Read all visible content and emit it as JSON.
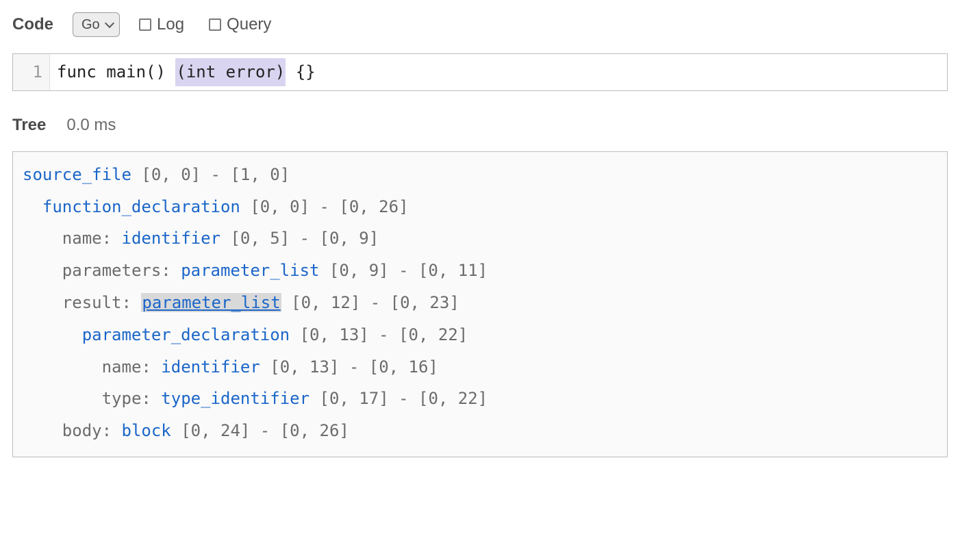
{
  "toolbar": {
    "code_label": "Code",
    "language_selected": "Go",
    "log_label": "Log",
    "query_label": "Query",
    "log_checked": false,
    "query_checked": false
  },
  "editor": {
    "line_number": "1",
    "segments": {
      "pre": "func main() ",
      "highlight": "(int error)",
      "post": " {}"
    }
  },
  "tree_header": {
    "label": "Tree",
    "timing": "0.0 ms"
  },
  "tree": [
    {
      "indent": 0,
      "field": null,
      "type": "source_file",
      "pos": "[0, 0] - [1, 0]",
      "selected": false
    },
    {
      "indent": 1,
      "field": null,
      "type": "function_declaration",
      "pos": "[0, 0] - [0, 26]",
      "selected": false
    },
    {
      "indent": 2,
      "field": "name",
      "type": "identifier",
      "pos": "[0, 5] - [0, 9]",
      "selected": false
    },
    {
      "indent": 2,
      "field": "parameters",
      "type": "parameter_list",
      "pos": "[0, 9] - [0, 11]",
      "selected": false
    },
    {
      "indent": 2,
      "field": "result",
      "type": "parameter_list",
      "pos": "[0, 12] - [0, 23]",
      "selected": true
    },
    {
      "indent": 3,
      "field": null,
      "type": "parameter_declaration",
      "pos": "[0, 13] - [0, 22]",
      "selected": false
    },
    {
      "indent": 4,
      "field": "name",
      "type": "identifier",
      "pos": "[0, 13] - [0, 16]",
      "selected": false
    },
    {
      "indent": 4,
      "field": "type",
      "type": "type_identifier",
      "pos": "[0, 17] - [0, 22]",
      "selected": false
    },
    {
      "indent": 2,
      "field": "body",
      "type": "block",
      "pos": "[0, 24] - [0, 26]",
      "selected": false
    }
  ]
}
